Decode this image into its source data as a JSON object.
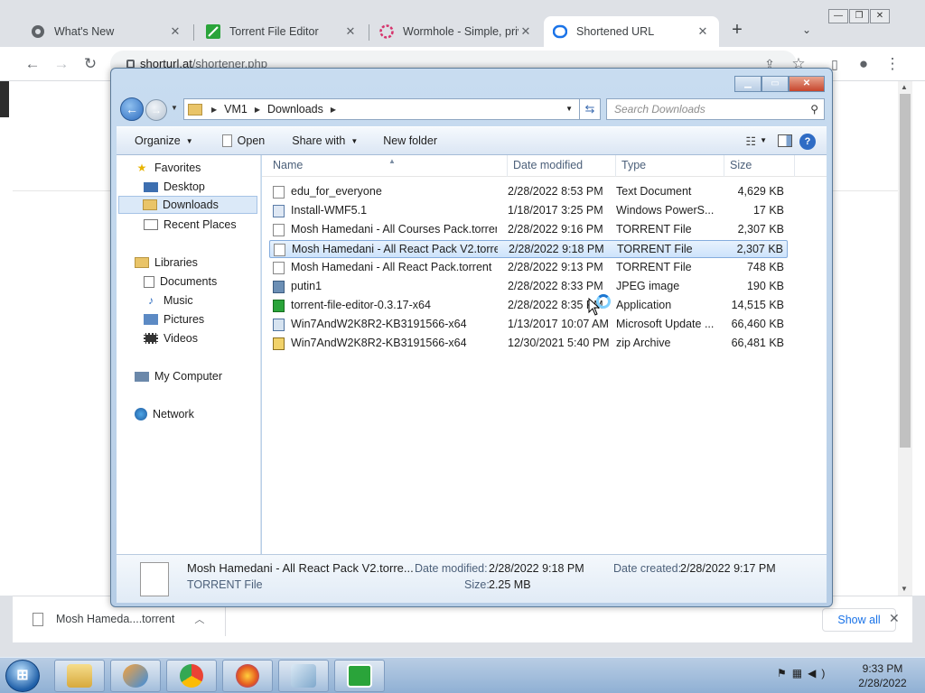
{
  "browser": {
    "tabs": [
      {
        "label": "What's New",
        "icon": "chrome-icon"
      },
      {
        "label": "Torrent File Editor",
        "icon": "torrent-editor-icon"
      },
      {
        "label": "Wormhole - Simple, priv",
        "icon": "wormhole-icon"
      },
      {
        "label": "Shortened URL",
        "icon": "shortener-icon"
      }
    ],
    "new_tab_label": "+",
    "url_host": "shorturl.at",
    "url_path": "/shortener.php",
    "download": {
      "filename": "Mosh Hameda....torrent",
      "show_all": "Show all"
    }
  },
  "dialog": {
    "breadcrumb": [
      "VM1",
      "Downloads"
    ],
    "search_placeholder": "Search Downloads",
    "toolbar": {
      "organize": "Organize",
      "open": "Open",
      "share_with": "Share with",
      "new_folder": "New folder"
    },
    "nav": {
      "favorites": "Favorites",
      "favorites_items": [
        "Desktop",
        "Downloads",
        "Recent Places"
      ],
      "libraries": "Libraries",
      "libraries_items": [
        "Documents",
        "Music",
        "Pictures",
        "Videos"
      ],
      "computer": "My Computer",
      "network": "Network"
    },
    "columns": {
      "name": "Name",
      "date": "Date modified",
      "type": "Type",
      "size": "Size"
    },
    "files": [
      {
        "name": "edu_for_everyone",
        "date": "2/28/2022 8:53 PM",
        "type": "Text Document",
        "size": "4,629 KB",
        "icon": "text-file-icon"
      },
      {
        "name": "Install-WMF5.1",
        "date": "1/18/2017 3:25 PM",
        "type": "Windows PowerS...",
        "size": "17 KB",
        "icon": "powershell-file-icon"
      },
      {
        "name": "Mosh Hamedani - All Courses Pack.torrent",
        "date": "2/28/2022 9:16 PM",
        "type": "TORRENT File",
        "size": "2,307 KB",
        "icon": "torrent-file-icon"
      },
      {
        "name": "Mosh Hamedani - All React Pack V2.torre...",
        "date": "2/28/2022 9:18 PM",
        "type": "TORRENT File",
        "size": "2,307 KB",
        "icon": "torrent-file-icon"
      },
      {
        "name": "Mosh Hamedani - All React Pack.torrent",
        "date": "2/28/2022 9:13 PM",
        "type": "TORRENT File",
        "size": "748 KB",
        "icon": "torrent-file-icon"
      },
      {
        "name": "putin1",
        "date": "2/28/2022 8:33 PM",
        "type": "JPEG image",
        "size": "190 KB",
        "icon": "jpeg-file-icon"
      },
      {
        "name": "torrent-file-editor-0.3.17-x64",
        "date": "2/28/2022 8:35 PM",
        "type": "Application",
        "size": "14,515 KB",
        "icon": "application-icon"
      },
      {
        "name": "Win7AndW2K8R2-KB3191566-x64",
        "date": "1/13/2017 10:07 AM",
        "type": "Microsoft Update ...",
        "size": "66,460 KB",
        "icon": "msu-file-icon"
      },
      {
        "name": "Win7AndW2K8R2-KB3191566-x64",
        "date": "12/30/2021 5:40 PM",
        "type": "zip Archive",
        "size": "66,481 KB",
        "icon": "zip-file-icon"
      }
    ],
    "selected_index": 3,
    "details": {
      "name": "Mosh Hamedani - All React Pack V2.torre...",
      "type": "TORRENT File",
      "date_modified_label": "Date modified:",
      "date_modified": "2/28/2022 9:18 PM",
      "date_created_label": "Date created:",
      "date_created": "2/28/2022 9:17 PM",
      "size_label": "Size:",
      "size": "2.25 MB"
    }
  },
  "taskbar": {
    "start_icon": "windows-start-icon",
    "apps": [
      "explorer-icon",
      "media-player-icon",
      "chrome-icon",
      "firefox-icon",
      "notepad-icon",
      "torrent-editor-icon"
    ],
    "time": "9:33 PM",
    "date": "2/28/2022"
  },
  "colors": {
    "accent": "#1a73e8",
    "selection": "#cde3fb",
    "taskbar": "#9fbcdc"
  }
}
